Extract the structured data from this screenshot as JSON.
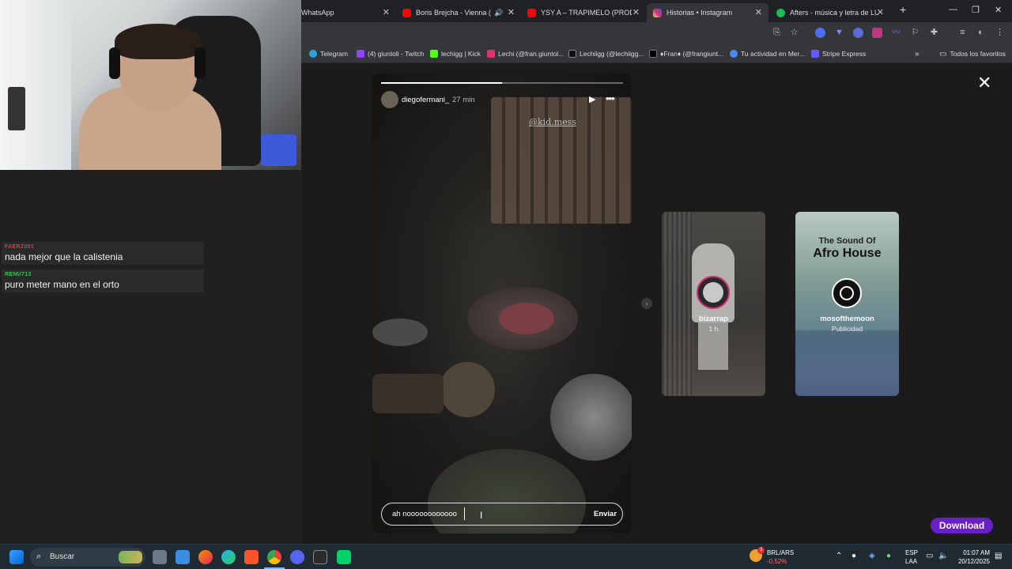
{
  "tabs": [
    {
      "title": "WhatsApp",
      "color": "#25d366"
    },
    {
      "title": "Boris Brejcha - Vienna (feat.",
      "color": "#ff0000"
    },
    {
      "title": "YSY A – TRAPIMELO (PROD. EVI",
      "color": "#ff0000"
    },
    {
      "title": "Historias • Instagram",
      "color": "#e1306c"
    },
    {
      "title": "Afters - música y letra de LUPO",
      "color": "#1db954"
    }
  ],
  "bookmarks": [
    {
      "label": "Telegram",
      "color": "#2aa1da"
    },
    {
      "label": "(4) giuntoli - Twitch",
      "color": "#9146ff"
    },
    {
      "label": "lechigg | Kick",
      "color": "#53fc18"
    },
    {
      "label": "Lechi (@fran.giuntol...",
      "color": "#e1306c"
    },
    {
      "label": "Lechiigg (@lechiigg...",
      "color": "#ffffff"
    },
    {
      "label": "♦Fran♦ (@frangiunt...",
      "color": "#ffffff"
    },
    {
      "label": "Tu actividad en Mer...",
      "color": "#4c8bf5"
    },
    {
      "label": "Stripe Express",
      "color": "#635bff"
    }
  ],
  "all_bookmarks": "Todos los favoritos",
  "chat": [
    {
      "user": "FAERZ001",
      "user_color": "#e23b3b",
      "text": "nada mejor que la calistenia"
    },
    {
      "user": "RENU713",
      "user_color": "#39c25a",
      "text": "puro meter mano en el orto"
    }
  ],
  "story": {
    "username": "diegofermani_",
    "time": "27 min",
    "progress": 0.5,
    "mention": "@kid.mess",
    "reply_text": "ah noooooooooooo",
    "send_label": "Enviar"
  },
  "side_stories": [
    {
      "username": "bizarrap",
      "sub": "1 h",
      "ring": "#d62976"
    },
    {
      "username": "mosofthemoon",
      "sub": "Publicidad",
      "title_line1": "The Sound Of",
      "title_line2": "Afro House",
      "ring": "#ffffff"
    }
  ],
  "download_label": "Download",
  "taskbar": {
    "search_label": "Buscar",
    "ticker_name": "BRL/ARS",
    "ticker_change": "-0,52%",
    "ticker_badge": "3",
    "lang1": "ESP",
    "lang2": "LAA",
    "time": "01:07 AM",
    "date": "20/12/2025"
  }
}
